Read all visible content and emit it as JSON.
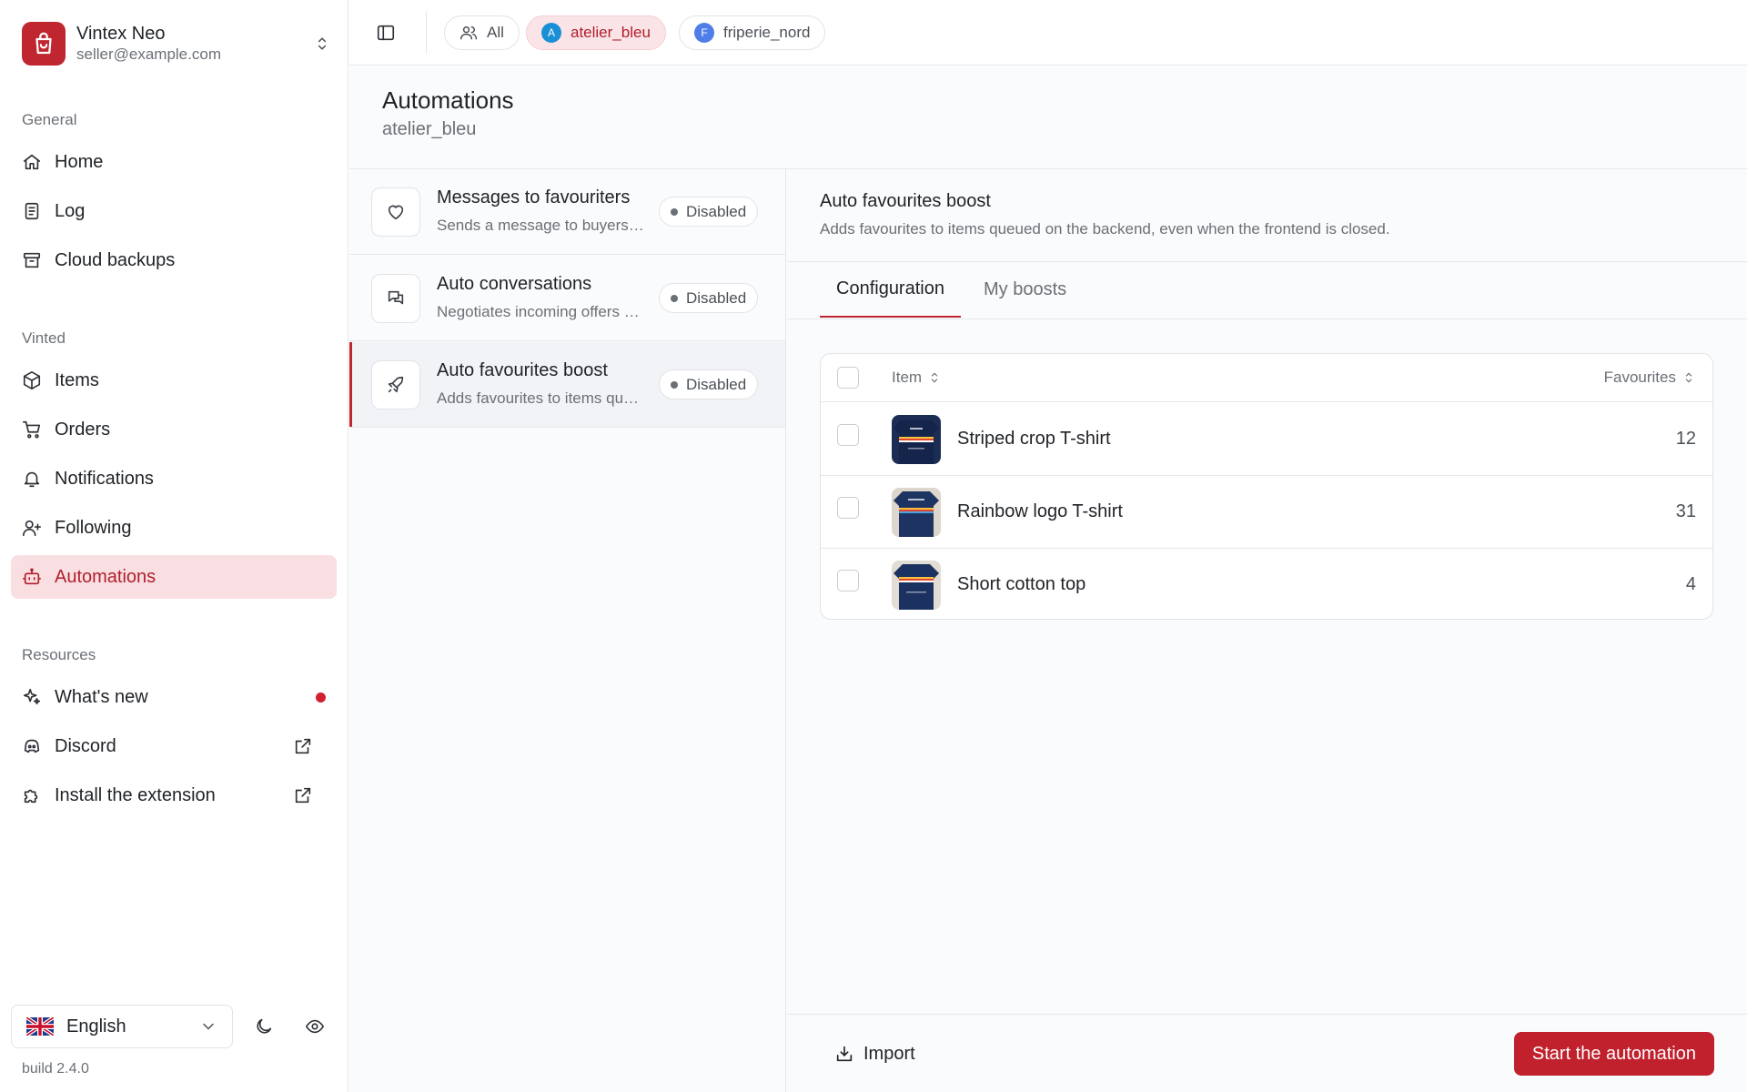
{
  "account": {
    "name": "Vintex Neo",
    "email": "seller@example.com",
    "icon": "shopping-bag-icon",
    "brand_color": "#c0262f"
  },
  "sidebar": {
    "sections": {
      "general": "General",
      "vinted": "Vinted",
      "resources": "Resources"
    },
    "general_items": [
      {
        "label": "Home",
        "icon": "home-icon"
      },
      {
        "label": "Log",
        "icon": "log-icon"
      },
      {
        "label": "Cloud backups",
        "icon": "archive-icon"
      }
    ],
    "vinted_items": [
      {
        "label": "Items",
        "icon": "package-icon"
      },
      {
        "label": "Orders",
        "icon": "cart-icon"
      },
      {
        "label": "Notifications",
        "icon": "bell-icon"
      },
      {
        "label": "Following",
        "icon": "user-plus-icon"
      },
      {
        "label": "Automations",
        "icon": "bot-icon",
        "active": true
      }
    ],
    "resource_items": [
      {
        "label": "What's new",
        "icon": "sparkles-icon"
      },
      {
        "label": "Discord",
        "icon": "discord-icon"
      },
      {
        "label": "Install the extension",
        "icon": "puzzle-icon"
      }
    ],
    "language": "English",
    "build": "build 2.4.0"
  },
  "topbar": {
    "chips": [
      {
        "label": "All",
        "icon": "users-icon"
      },
      {
        "label": "atelier_bleu",
        "avatar": "A",
        "avatar_color": "#1a8fd6",
        "active": true
      },
      {
        "label": "friperie_nord",
        "avatar": "F",
        "avatar_color": "#4f7ee8"
      }
    ]
  },
  "page": {
    "title": "Automations",
    "subtitle": "atelier_bleu"
  },
  "automations": [
    {
      "title": "Messages to favouriters",
      "desc": "Sends a message to buyers who favourite your items",
      "status": "Disabled",
      "icon": "heart-icon"
    },
    {
      "title": "Auto conversations",
      "desc": "Negotiates incoming offers automatically",
      "status": "Disabled",
      "icon": "chat-icon"
    },
    {
      "title": "Auto favourites boost",
      "desc": "Adds favourites to items queued on the backend",
      "status": "Disabled",
      "icon": "rocket-icon",
      "selected": true
    }
  ],
  "detail": {
    "title": "Auto favourites boost",
    "desc": "Adds favourites to items queued on the backend, even when the frontend is closed.",
    "tabs": [
      "Configuration",
      "My boosts"
    ],
    "table": {
      "headers": {
        "item": "Item",
        "favourites": "Favourites"
      },
      "rows": [
        {
          "name": "Striped crop T-shirt",
          "favourites": "12"
        },
        {
          "name": "Rainbow logo T-shirt",
          "favourites": "31"
        },
        {
          "name": "Short cotton top",
          "favourites": "4"
        }
      ]
    },
    "import_label": "Import",
    "start_label": "Start the automation"
  }
}
